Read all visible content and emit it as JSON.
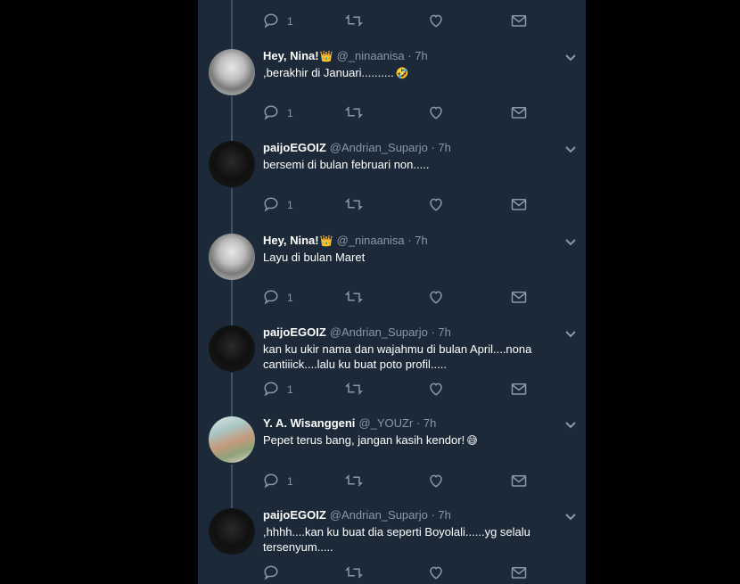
{
  "timeline": {
    "top_action_bar": {
      "reply_count": "1"
    },
    "tweets": [
      {
        "name": "Hey, Nina!",
        "badge": "👑",
        "handle": "@_ninaanisa",
        "time": "7h",
        "text_lines": [
          ",berakhir di Januari.........."
        ],
        "emoji": "🤣",
        "reply_count": "1",
        "avatar": "nina"
      },
      {
        "name": "paijoEGOIZ",
        "badge": "",
        "handle": "@Andrian_Suparjo",
        "time": "7h",
        "text_lines": [
          "bersemi di bulan februari non....."
        ],
        "emoji": "",
        "reply_count": "1",
        "avatar": "paijo"
      },
      {
        "name": "Hey, Nina!",
        "badge": "👑",
        "handle": "@_ninaanisa",
        "time": "7h",
        "text_lines": [
          "Layu di bulan Maret"
        ],
        "emoji": "",
        "reply_count": "1",
        "avatar": "nina"
      },
      {
        "name": "paijoEGOIZ",
        "badge": "",
        "handle": "@Andrian_Suparjo",
        "time": "7h",
        "text_lines": [
          "kan ku ukir nama dan wajahmu di bulan April....nona",
          "cantiiick....lalu ku buat poto profil....."
        ],
        "emoji": "",
        "reply_count": "1",
        "avatar": "paijo"
      },
      {
        "name": "Y. A. Wisanggeni",
        "badge": "",
        "handle": "@_YOUZr",
        "time": "7h",
        "text_lines": [
          "Pepet terus bang, jangan kasih kendor!"
        ],
        "emoji": "😅",
        "reply_count": "1",
        "avatar": "wisang"
      },
      {
        "name": "paijoEGOIZ",
        "badge": "",
        "handle": "@Andrian_Suparjo",
        "time": "7h",
        "text_lines": [
          ",hhhh....kan ku buat dia seperti Boyolali......yg selalu",
          "tersenyum....."
        ],
        "emoji": "",
        "reply_count": "",
        "avatar": "paijo"
      }
    ],
    "separator": "·"
  },
  "icons": {
    "reply": "reply-icon",
    "retweet": "retweet-icon",
    "like": "heart-icon",
    "message": "envelope-icon",
    "more": "chevron-down-icon"
  },
  "colors": {
    "background": "#1c2938",
    "page_background": "#000000",
    "text_primary": "#ffffff",
    "text_secondary": "#8899a6",
    "thread_line": "#3d5466"
  }
}
